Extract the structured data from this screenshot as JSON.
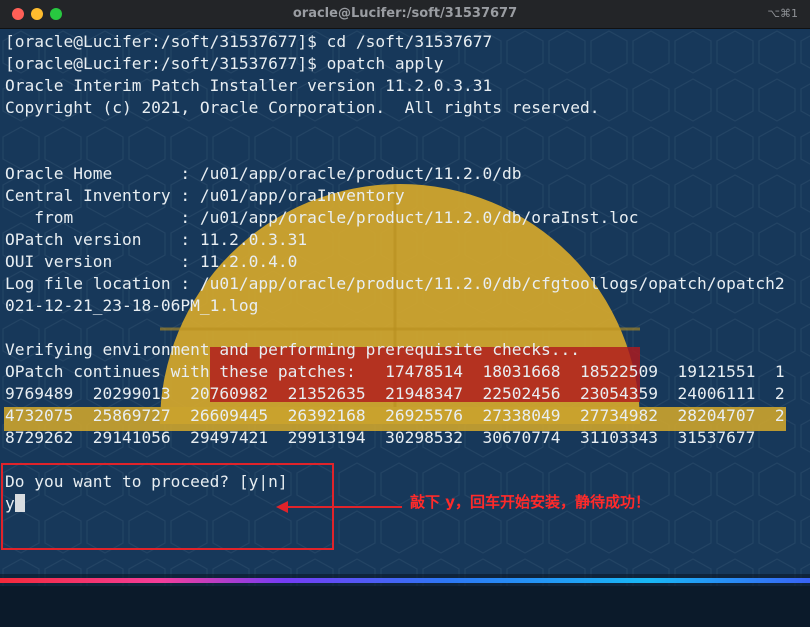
{
  "window": {
    "title": "oracle@Lucifer:/soft/31537677",
    "shortcut": "⌥⌘1"
  },
  "terminal": {
    "lines": [
      "[oracle@Lucifer:/soft/31537677]$ cd /soft/31537677",
      "[oracle@Lucifer:/soft/31537677]$ opatch apply",
      "Oracle Interim Patch Installer version 11.2.0.3.31",
      "Copyright (c) 2021, Oracle Corporation.  All rights reserved.",
      "",
      "",
      "Oracle Home       : /u01/app/oracle/product/11.2.0/db",
      "Central Inventory : /u01/app/oraInventory",
      "   from           : /u01/app/oracle/product/11.2.0/db/oraInst.loc",
      "OPatch version    : 11.2.0.3.31",
      "OUI version       : 11.2.0.4.0",
      "Log file location : /u01/app/oracle/product/11.2.0/db/cfgtoollogs/opatch/opatch2",
      "021-12-21_23-18-06PM_1.log",
      "",
      "Verifying environment and performing prerequisite checks...",
      "OPatch continues with these patches:   17478514  18031668  18522509  19121551  1",
      "9769489  20299013  20760982  21352635  21948347  22502456  23054359  24006111  2",
      "4732075  25869727  26609445  26392168  26925576  27338049  27734982  28204707  2",
      "8729262  29141056  29497421  29913194  30298532  30670774  31103343  31537677",
      "",
      "Do you want to proceed? [y|n]"
    ],
    "input": "y"
  },
  "annotation": {
    "text": "敲下 y，回车开始安装，静待成功！",
    "color": "#ff2a2a"
  }
}
